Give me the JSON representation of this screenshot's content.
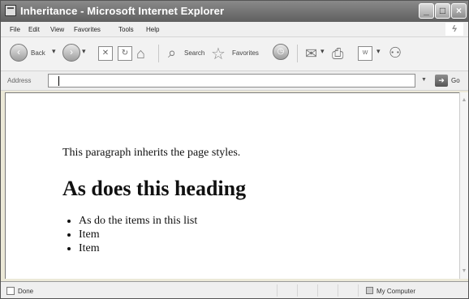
{
  "window": {
    "title": "Inheritance - Microsoft Internet Explorer"
  },
  "menu": {
    "items": [
      "File",
      "Edit",
      "View",
      "Favorites",
      "Tools",
      "Help"
    ]
  },
  "toolbar": {
    "back_label": "Back",
    "search_label": "Search",
    "favorites_label": "Favorites"
  },
  "address": {
    "label": "Address",
    "value": "",
    "go_label": "Go"
  },
  "page": {
    "paragraph": "This paragraph inherits the page styles.",
    "heading": "As does this heading",
    "list_items": [
      "As do the items in this list",
      "Item",
      "Item"
    ]
  },
  "status": {
    "text": "Done",
    "zone": "My Computer"
  },
  "icons": {
    "app": "ie-page-icon",
    "back": "back-arrow-icon",
    "forward": "forward-arrow-icon",
    "stop": "stop-icon",
    "refresh": "refresh-icon",
    "home": "home-icon",
    "search": "search-icon",
    "favorites": "favorites-star-icon",
    "history": "history-icon",
    "mail": "mail-icon",
    "print": "print-icon",
    "edit": "edit-icon",
    "messenger": "messenger-icon",
    "go": "go-arrow-icon",
    "scroll_up": "scroll-up-icon",
    "scroll_down": "scroll-down-icon",
    "status": "page-status-icon",
    "zone": "computer-zone-icon"
  }
}
